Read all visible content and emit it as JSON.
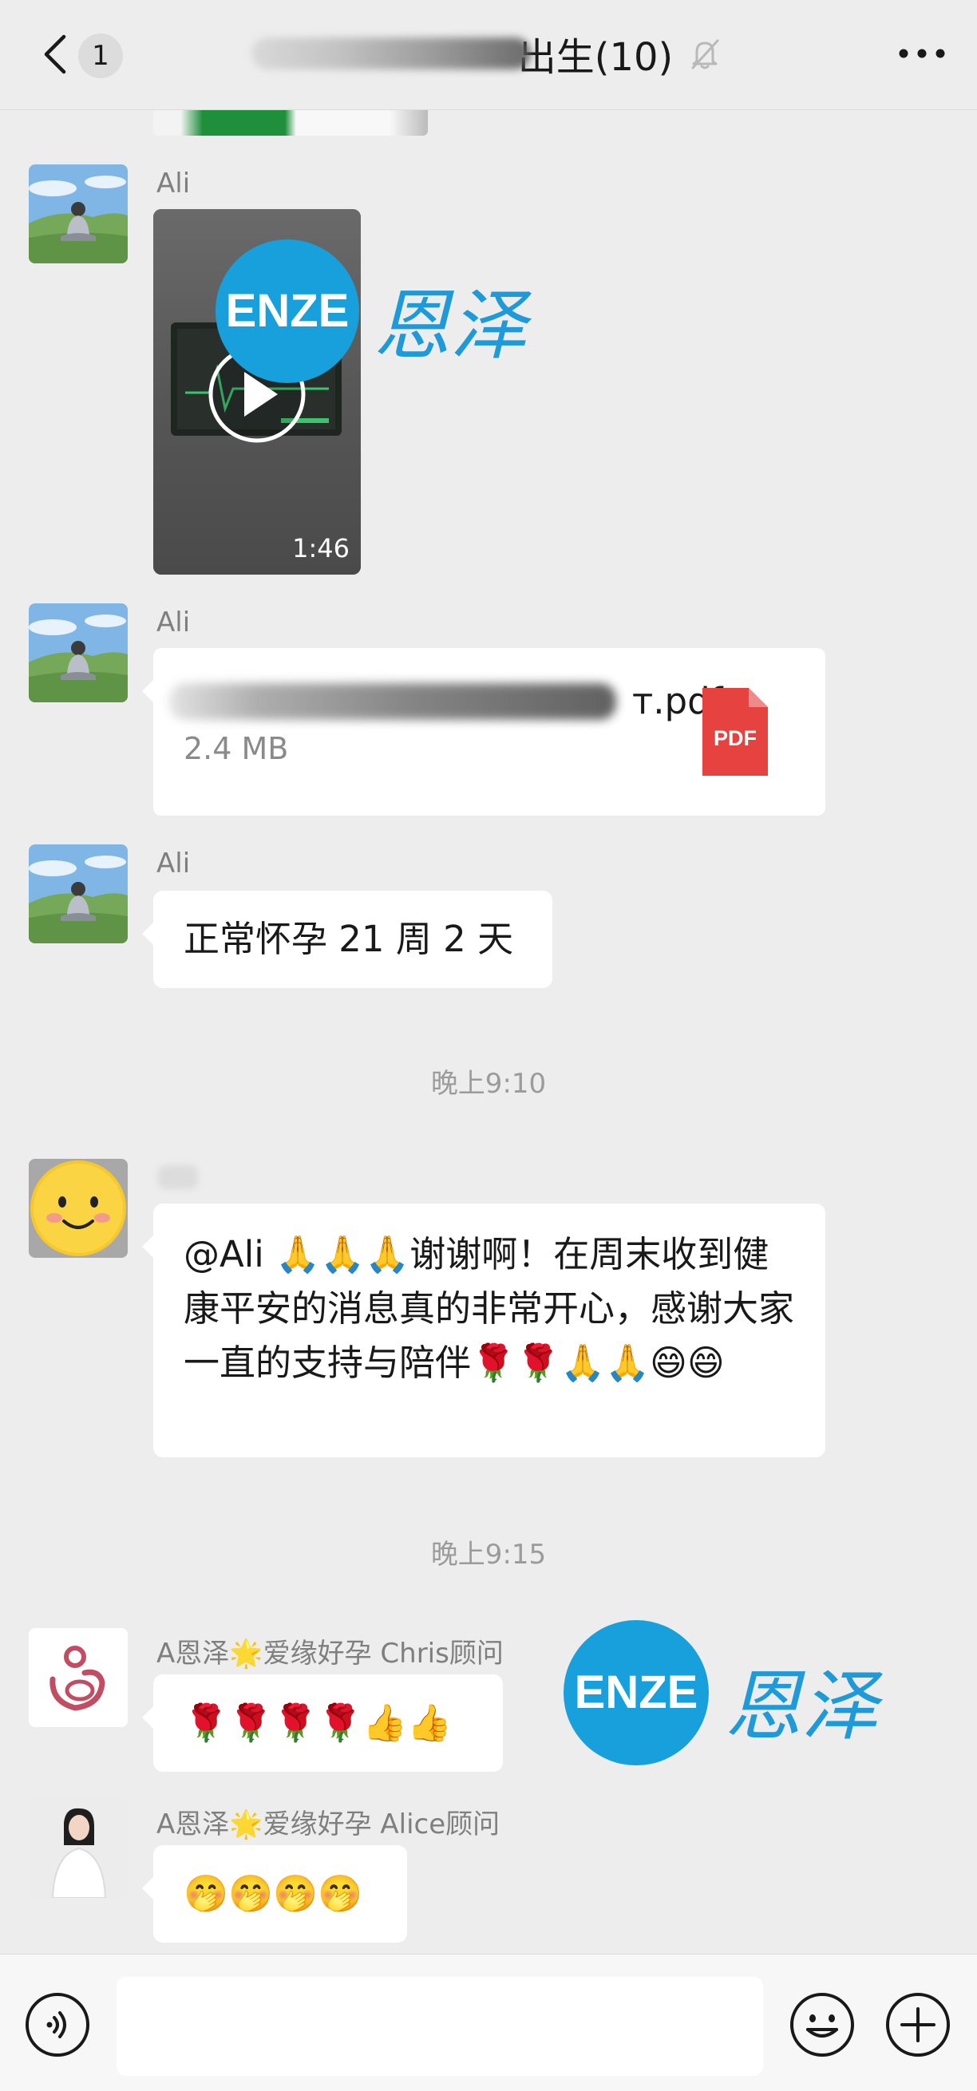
{
  "header": {
    "unread_count": "1",
    "title": "出生(10)",
    "muted_icon": "bell-off-icon",
    "more_icon": "more-dots-icon"
  },
  "messages": {
    "video": {
      "sender": "Ali",
      "duration": "1:46"
    },
    "file": {
      "sender": "Ali",
      "name": "т.pdf",
      "size": "2.4 MB",
      "type_label": "PDF"
    },
    "text1": {
      "sender": "Ali",
      "text": "正常怀孕 21 周 2 天"
    },
    "time1": "晚上9:10",
    "reply": {
      "mention": "@Ali",
      "emoji_prefix": "🙏🙏🙏",
      "text": "谢谢啊！在周末收到健康平安的消息真的非常开心，感谢大家一直的支持与陪伴",
      "emoji_suffix": "🌹🌹🙏🙏😄😄"
    },
    "time2": "晚上9:15",
    "chris": {
      "sender": "A恩泽🌟爱缘好孕 Chris顾问",
      "emojis": "🌹🌹🌹🌹👍👍"
    },
    "alice": {
      "sender": "A恩泽🌟爱缘好孕 Alice顾问",
      "emojis": "🤭🤭🤭🤭"
    }
  },
  "watermark": {
    "logo": "ENZE",
    "chars": "恩泽"
  },
  "colors": {
    "background": "#ededed",
    "bubble": "#ffffff",
    "watermark_blue": "#17a0dc",
    "pdf_red": "#e64340"
  }
}
